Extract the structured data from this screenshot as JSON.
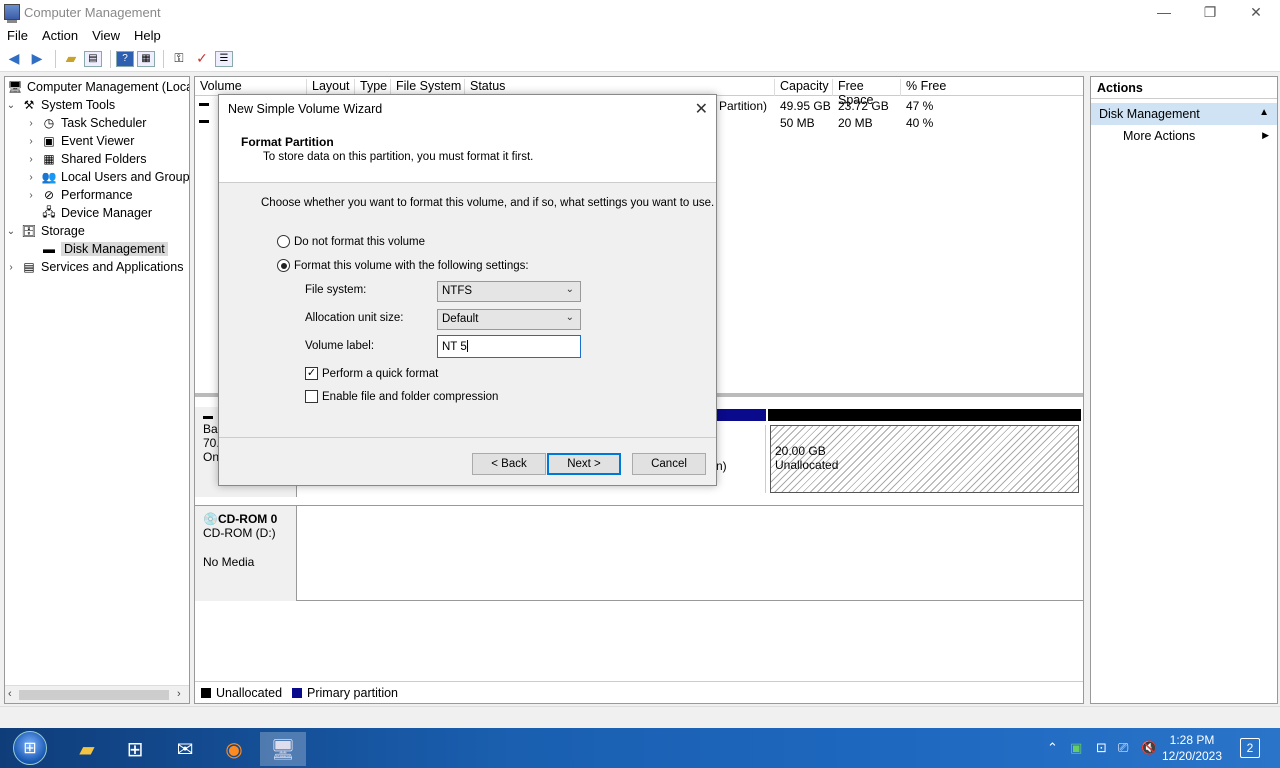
{
  "window": {
    "title": "Computer Management",
    "minimize": "—",
    "restore": "❐",
    "close": "✕"
  },
  "menu": [
    "File",
    "Action",
    "View",
    "Help"
  ],
  "tree": {
    "root": "Computer Management (Local",
    "system_tools": "System Tools",
    "task_scheduler": "Task Scheduler",
    "event_viewer": "Event Viewer",
    "shared_folders": "Shared Folders",
    "local_users": "Local Users and Groups",
    "performance": "Performance",
    "device_manager": "Device Manager",
    "storage": "Storage",
    "disk_management": "Disk Management",
    "services": "Services and Applications"
  },
  "volume_list": {
    "columns": [
      "Volume",
      "Layout",
      "Type",
      "File System",
      "Status",
      "Capacity",
      "Free Space",
      "% Free"
    ],
    "rows": [
      {
        "status": "Partition)",
        "capacity": "49.95 GB",
        "free": "23.72 GB",
        "pct": "47 %"
      },
      {
        "status": "",
        "capacity": "50 MB",
        "free": "20 MB",
        "pct": "40 %"
      }
    ]
  },
  "disk0": {
    "label_line1": "Ba",
    "label_line2": "70.",
    "label_line3": "On",
    "frag": "n)",
    "unalloc_size": "20.00 GB",
    "unalloc_label": "Unallocated"
  },
  "cdrom": {
    "title": "CD-ROM 0",
    "drive": "CD-ROM (D:)",
    "media": "No Media"
  },
  "legend": {
    "unallocated": "Unallocated",
    "primary": "Primary partition",
    "unallocated_color": "#000000",
    "primary_color": "#0a0a8c"
  },
  "actions": {
    "header": "Actions",
    "section": "Disk Management",
    "more": "More Actions"
  },
  "dialog": {
    "title": "New Simple Volume Wizard",
    "heading": "Format Partition",
    "subheading": "To store data on this partition, you must format it first.",
    "intro": "Choose whether you want to format this volume, and if so, what settings you want to use.",
    "opt_no_format": "Do not format this volume",
    "opt_format": "Format this volume with the following settings:",
    "fs_label": "File system:",
    "fs_value": "NTFS",
    "alloc_label": "Allocation unit size:",
    "alloc_value": "Default",
    "vol_label": "Volume label:",
    "vol_value": "NT 5",
    "quick_format": "Perform a quick format",
    "compression": "Enable file and folder compression",
    "back": "< Back",
    "next": "Next >",
    "cancel": "Cancel"
  },
  "taskbar": {
    "time": "1:28 PM",
    "date": "12/20/2023",
    "notifications": "2"
  }
}
